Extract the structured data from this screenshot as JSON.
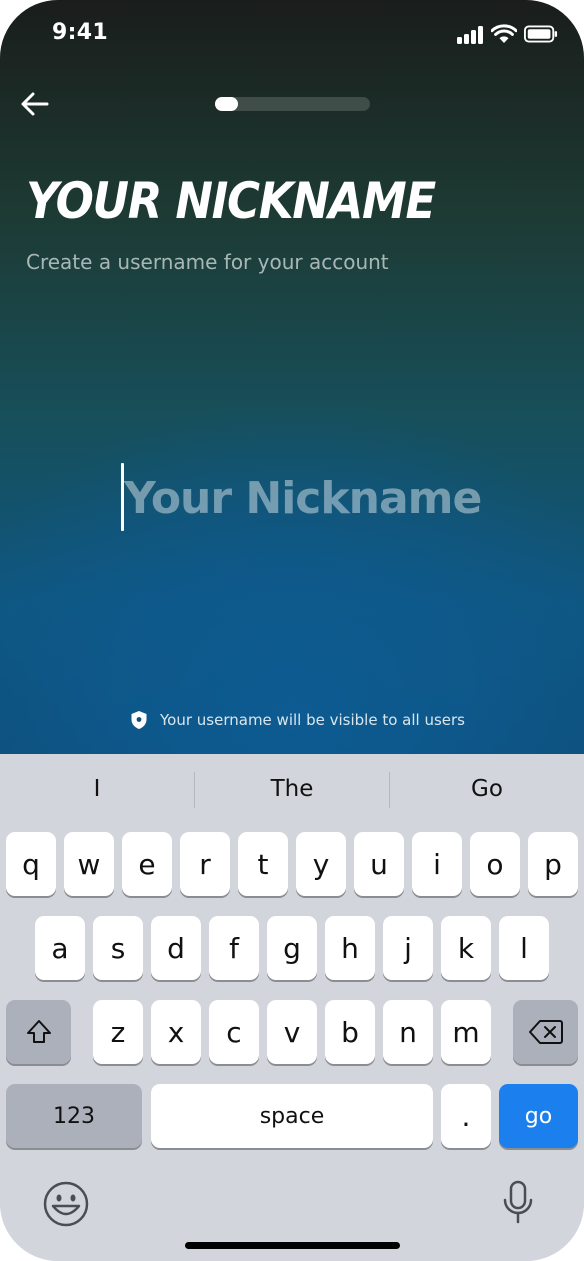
{
  "status_bar": {
    "time": "9:41"
  },
  "header": {
    "title": "YOUR NICKNAME",
    "subtitle": "Create a username for your account",
    "progress": 0.15
  },
  "nickname_input": {
    "value": "",
    "placeholder": "Your Nickname"
  },
  "notice": {
    "text": "Your username will be visible to all users"
  },
  "keyboard": {
    "suggestions": [
      "I",
      "The",
      "Go"
    ],
    "row1": [
      "q",
      "w",
      "e",
      "r",
      "t",
      "y",
      "u",
      "i",
      "o",
      "p"
    ],
    "row2": [
      "a",
      "s",
      "d",
      "f",
      "g",
      "h",
      "j",
      "k",
      "l"
    ],
    "row3": [
      "z",
      "x",
      "c",
      "v",
      "b",
      "n",
      "m"
    ],
    "numbers_label": "123",
    "space_label": "space",
    "period_label": ".",
    "go_label": "go"
  },
  "colors": {
    "accent": "#1b80ee",
    "hero_top": "#1a1d1b",
    "hero_bottom": "#0e4f7a",
    "keyboard_bg": "#d2d5db"
  }
}
